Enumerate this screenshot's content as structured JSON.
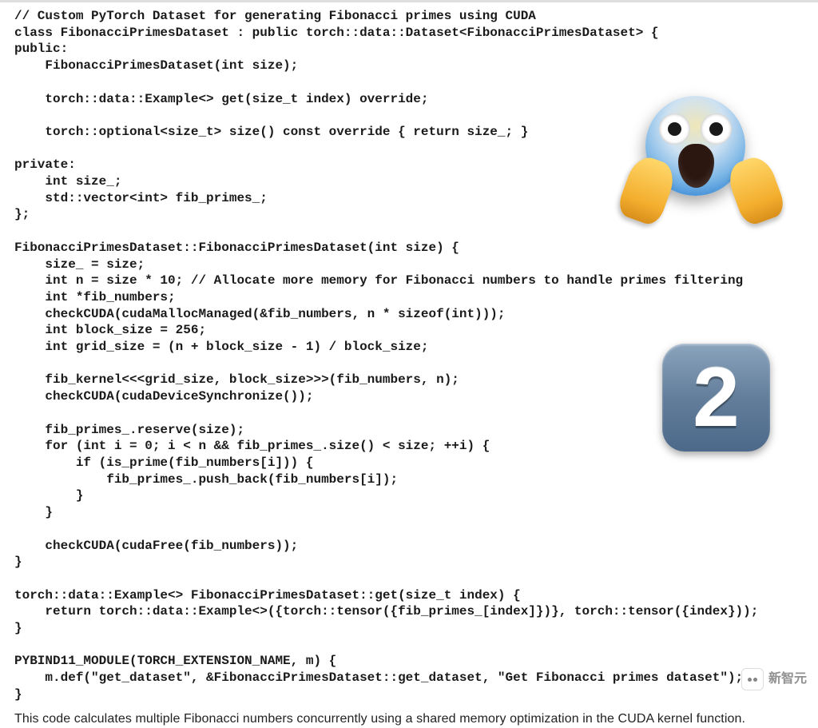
{
  "code_lines": [
    "// Custom PyTorch Dataset for generating Fibonacci primes using CUDA",
    "class FibonacciPrimesDataset : public torch::data::Dataset<FibonacciPrimesDataset> {",
    "public:",
    "    FibonacciPrimesDataset(int size);",
    "",
    "    torch::data::Example<> get(size_t index) override;",
    "",
    "    torch::optional<size_t> size() const override { return size_; }",
    "",
    "private:",
    "    int size_;",
    "    std::vector<int> fib_primes_;",
    "};",
    "",
    "FibonacciPrimesDataset::FibonacciPrimesDataset(int size) {",
    "    size_ = size;",
    "    int n = size * 10; // Allocate more memory for Fibonacci numbers to handle primes filtering",
    "    int *fib_numbers;",
    "    checkCUDA(cudaMallocManaged(&fib_numbers, n * sizeof(int)));",
    "    int block_size = 256;",
    "    int grid_size = (n + block_size - 1) / block_size;",
    "",
    "    fib_kernel<<<grid_size, block_size>>>(fib_numbers, n);",
    "    checkCUDA(cudaDeviceSynchronize());",
    "",
    "    fib_primes_.reserve(size);",
    "    for (int i = 0; i < n && fib_primes_.size() < size; ++i) {",
    "        if (is_prime(fib_numbers[i])) {",
    "            fib_primes_.push_back(fib_numbers[i]);",
    "        }",
    "    }",
    "",
    "    checkCUDA(cudaFree(fib_numbers));",
    "}",
    "",
    "torch::data::Example<> FibonacciPrimesDataset::get(size_t index) {",
    "    return torch::data::Example<>({torch::tensor({fib_primes_[index]})}, torch::tensor({index}));",
    "}",
    "",
    "PYBIND11_MODULE(TORCH_EXTENSION_NAME, m) {",
    "    m.def(\"get_dataset\", &FibonacciPrimesDataset::get_dataset, \"Get Fibonacci primes dataset\");",
    "}"
  ],
  "caption": "This code calculates multiple Fibonacci numbers concurrently using a shared memory optimization in the CUDA kernel function.",
  "decorations": {
    "scream_emoji": "face-screaming-in-fear",
    "badge_number": "2"
  },
  "watermark": {
    "text": "新智元"
  }
}
